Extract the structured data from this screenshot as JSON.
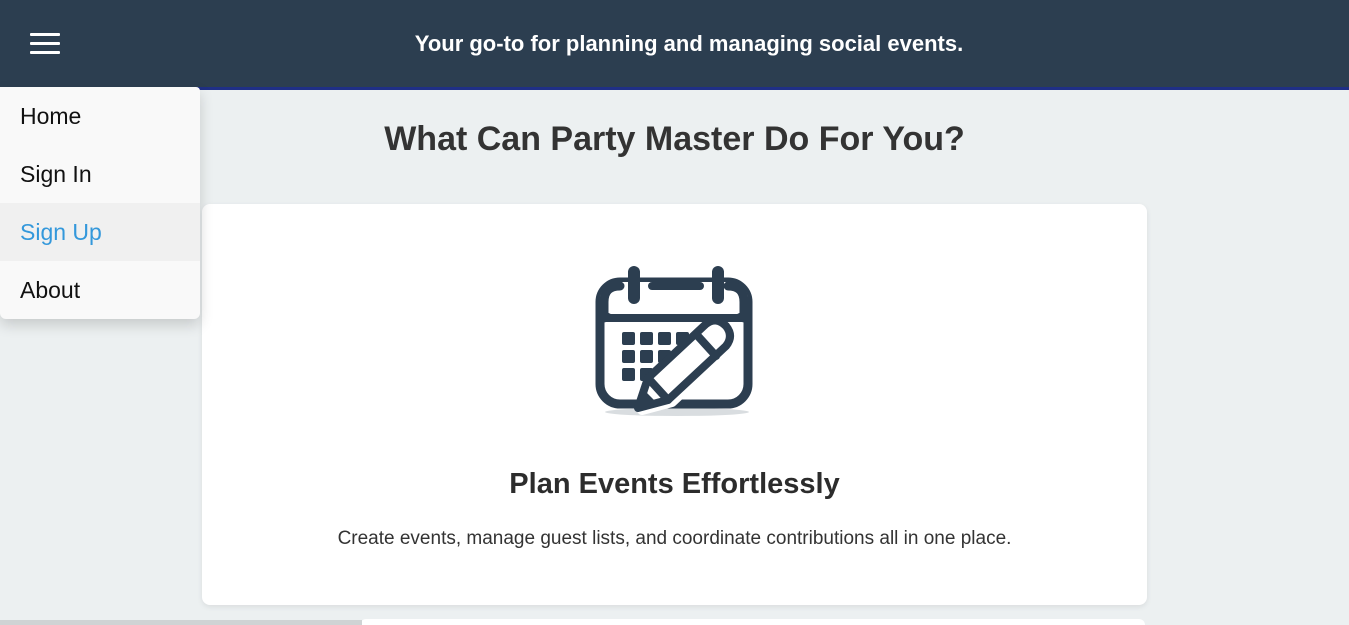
{
  "header": {
    "tagline": "Your go-to for planning and managing social events.",
    "menu_icon": "hamburger-menu-icon"
  },
  "nav_menu": {
    "items": [
      {
        "label": "Home"
      },
      {
        "label": "Sign In"
      },
      {
        "label": "Sign Up",
        "state": "hovered"
      },
      {
        "label": "About"
      }
    ]
  },
  "main": {
    "heading": "What Can Party Master Do For You?",
    "features": [
      {
        "icon": "calendar-pencil-icon",
        "title": "Plan Events Effortlessly",
        "description": "Create events, manage guest lists, and coordinate contributions all in one place."
      }
    ]
  },
  "colors": {
    "header_bg": "#2c3e50",
    "page_bg": "#ecf0f1",
    "accent": "#3498db",
    "icon": "#2c3e50"
  }
}
